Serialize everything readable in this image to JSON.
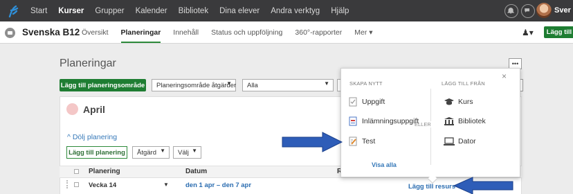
{
  "topbar": {
    "nav": [
      "Start",
      "Kurser",
      "Grupper",
      "Kalender",
      "Bibliotek",
      "Dina elever",
      "Andra verktyg",
      "Hjälp"
    ],
    "active_index": 1,
    "user_name": "Sver"
  },
  "course": {
    "title": "Svenska B12",
    "tabs": [
      "Översikt",
      "Planeringar",
      "Innehåll",
      "Status och uppföljning",
      "360°-rapporter",
      "Mer ▾"
    ],
    "active_index": 1,
    "add_button": "Lägg till"
  },
  "page": {
    "title": "Planeringar",
    "add_area_button": "Lägg till planeringsområde",
    "area_actions_select": "Planeringsområde åtgärder",
    "filter_select": "Alla",
    "filter_partial": "V",
    "lista_button": "ista",
    "ellipsis": "•••"
  },
  "section": {
    "month": "April",
    "hide_link": "^ Dölj planering",
    "add_plan_button": "Lägg till planering",
    "action_select": "Åtgärd",
    "choose_select": "Välj"
  },
  "table": {
    "headers": [
      "Planering",
      "Datum",
      "R"
    ],
    "rows": [
      {
        "name": "Vecka 14",
        "date": "den 1 apr – den 7 apr",
        "resource": "Lägg till resurs"
      }
    ]
  },
  "popup": {
    "create_heading": "SKAPA NYTT",
    "from_heading": "LÄGG TILL FRÅN",
    "create_items": [
      {
        "label": "Uppgift",
        "icon": "assignment-icon"
      },
      {
        "label": "Inlämningsuppgift",
        "icon": "submission-icon"
      },
      {
        "label": "Test",
        "icon": "test-icon"
      }
    ],
    "from_items": [
      {
        "label": "Kurs",
        "icon": "graduation-cap-icon"
      },
      {
        "label": "Bibliotek",
        "icon": "library-icon"
      },
      {
        "label": "Dator",
        "icon": "computer-icon"
      }
    ],
    "or_label": "ELLER",
    "show_all": "Visa alla",
    "close": "×"
  },
  "colors": {
    "topbar": "#3a3a3c",
    "accent_green": "#1e7d32",
    "link_blue": "#3578b8",
    "annotation_arrow": "#2e5db8"
  }
}
